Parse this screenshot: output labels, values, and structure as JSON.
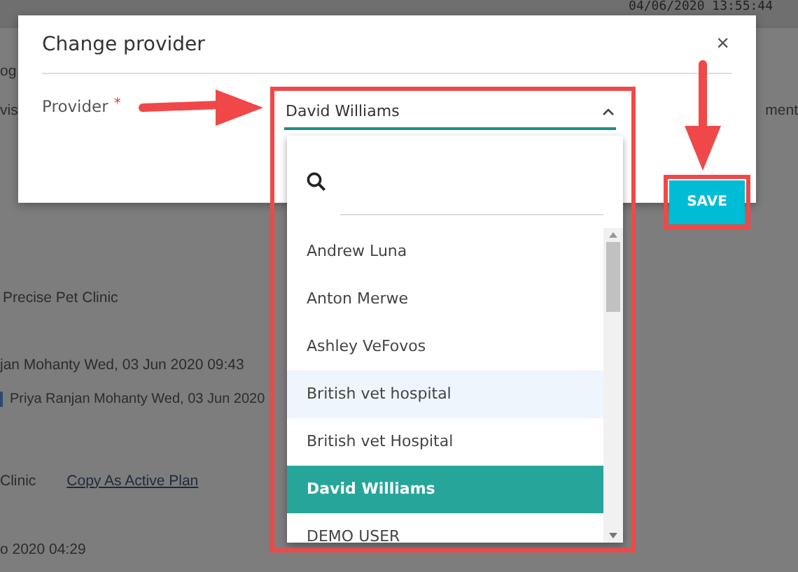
{
  "background_page": {
    "datetime": "04/06/2020 13:55:44",
    "rows": [
      {
        "texts": [
          {
            "text": "og",
            "kind": "plain"
          }
        ]
      },
      {
        "texts": [
          {
            "text": "vis",
            "kind": "plain"
          },
          {
            "text": "ment",
            "kind": "right"
          }
        ]
      },
      {
        "texts": [
          {
            "text": "Precise Pet Clinic",
            "kind": "plain"
          }
        ]
      },
      {
        "texts": [
          {
            "text": "jan Mohanty Wed, 03 Jun 2020 09:43",
            "kind": "plain"
          }
        ]
      },
      {
        "texts": [
          {
            "text": "Priya Ranjan Mohanty Wed, 03 Jun 2020",
            "kind": "marked"
          }
        ]
      },
      {
        "texts": [
          {
            "text": "Clinic",
            "kind": "plain"
          },
          {
            "text": "Copy As Active Plan",
            "kind": "link"
          }
        ]
      },
      {
        "texts": [
          {
            "text": "o 2020 04:29",
            "kind": "plain"
          }
        ]
      }
    ]
  },
  "modal": {
    "title": "Change provider",
    "close": "×",
    "field": {
      "label": "Provider",
      "required_mark": "*",
      "value": "David Williams",
      "expanded": true
    },
    "dropdown": {
      "options": [
        {
          "label": "Andrew Luna",
          "selected": false,
          "highlighted": false
        },
        {
          "label": "Anton Merwe",
          "selected": false,
          "highlighted": false
        },
        {
          "label": "Ashley VeFovos",
          "selected": false,
          "highlighted": false
        },
        {
          "label": "British vet hospital",
          "selected": false,
          "highlighted": true
        },
        {
          "label": "British vet Hospital",
          "selected": false,
          "highlighted": false
        },
        {
          "label": "David Williams",
          "selected": true,
          "highlighted": false
        },
        {
          "label": "DEMO USER",
          "selected": false,
          "highlighted": false
        }
      ]
    },
    "save_button": "SAVE"
  },
  "annotations": [
    {
      "kind": "arrow-right"
    },
    {
      "kind": "arrow-down"
    },
    {
      "kind": "box-dropdown"
    },
    {
      "kind": "box-save"
    }
  ]
}
